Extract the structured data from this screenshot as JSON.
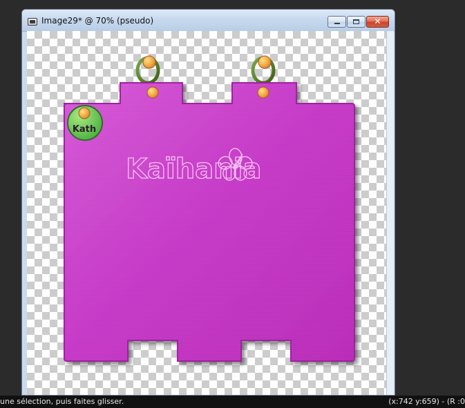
{
  "window": {
    "title": "Image29* @  70% (pseudo)",
    "controls": {
      "minimize": "minimize",
      "maximize": "maximize",
      "close": "✕"
    }
  },
  "artwork": {
    "brand": "Kaïhania",
    "badge": "Kath",
    "colors": {
      "magenta": "#d447d3",
      "badge_green": "#7bcd5c",
      "ring_green": "#5a7d22",
      "bead_orange": "#efb03a"
    }
  },
  "statusbar": {
    "hint": "une sélection, puis faites glisser.",
    "coords": "(x:742 y:659) - (R :0"
  }
}
